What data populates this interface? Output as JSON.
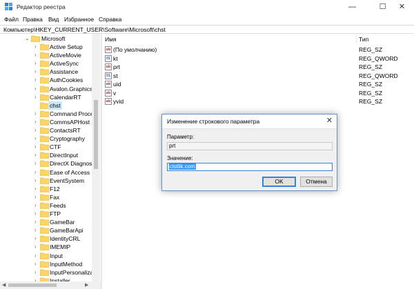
{
  "window": {
    "title": "Редактор реестра",
    "buttons": {
      "minimize": "—",
      "maximize": "☐",
      "close": "✕"
    }
  },
  "menu": [
    "Файл",
    "Правка",
    "Вид",
    "Избранное",
    "Справка"
  ],
  "address": "Компьютер\\HKEY_CURRENT_USER\\Software\\Microsoft\\chst",
  "tree": {
    "parent": "Microsoft",
    "items": [
      "Active Setup",
      "ActiveMovie",
      "ActiveSync",
      "Assistance",
      "AuthCookies",
      "Avalon.Graphics",
      "CalendarRT",
      "chst",
      "Command Proce",
      "CommsAPHost",
      "ContactsRT",
      "Cryptography",
      "CTF",
      "DirectInput",
      "DirectX Diagnosti",
      "Ease of Access",
      "EventSystem",
      "F12",
      "Fax",
      "Feeds",
      "FTP",
      "GameBar",
      "GameBarApi",
      "IdentityCRL",
      "IMEMIP",
      "Input",
      "InputMethod",
      "InputPersonalizat",
      "Installer"
    ],
    "selected": "chst"
  },
  "list": {
    "columns": {
      "name": "Имя",
      "type": "Тип"
    },
    "rows": [
      {
        "name": "(По умолчанию)",
        "type": "REG_SZ",
        "icon": "string-value-icon"
      },
      {
        "name": "kt",
        "type": "REG_QWORD",
        "icon": "binary-value-icon"
      },
      {
        "name": "prt",
        "type": "REG_SZ",
        "icon": "string-value-icon"
      },
      {
        "name": "st",
        "type": "REG_QWORD",
        "icon": "binary-value-icon"
      },
      {
        "name": "uid",
        "type": "REG_SZ",
        "icon": "string-value-icon"
      },
      {
        "name": "v",
        "type": "REG_SZ",
        "icon": "string-value-icon"
      },
      {
        "name": "yvid",
        "type": "REG_SZ",
        "icon": "string-value-icon"
      }
    ]
  },
  "dialog": {
    "title": "Изменение строкового параметра",
    "param_label": "Параметр:",
    "param_value": "prt",
    "value_label": "Значение:",
    "value_value": "clstlik.com",
    "ok": "OK",
    "cancel": "Отмена",
    "close": "✕"
  },
  "colors": {
    "selection": "#cce8ff",
    "text_selection": "#3399ff",
    "folder": "#ffd666"
  }
}
